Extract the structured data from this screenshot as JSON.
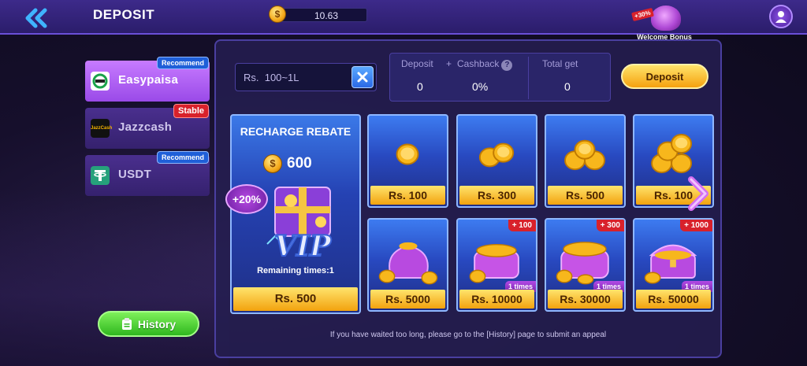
{
  "header": {
    "title": "DEPOSIT",
    "balance": "10.63",
    "welcome_bonus": "Welcome Bonus",
    "bonus_tag": "+30%"
  },
  "methods": [
    {
      "label": "Easypaisa",
      "badge": "Recommend",
      "badge_color": "#1f5fd8",
      "active": true
    },
    {
      "label": "Jazzcash",
      "badge": "Stable",
      "badge_color": "#d8212b",
      "icon_text": "JazzCash",
      "active": false
    },
    {
      "label": "USDT",
      "badge": "Recommend",
      "badge_color": "#1f5fd8",
      "active": false
    }
  ],
  "history_button": "History",
  "input": {
    "currency": "Rs.",
    "placeholder": "Rs.  100~1L"
  },
  "summary": {
    "deposit_label": "Deposit",
    "plus": "+",
    "cashback_label": "Cashback",
    "help_icon": "?",
    "total_label": "Total get",
    "deposit_value": "0",
    "cashback_value": "0%",
    "total_value": "0"
  },
  "deposit_button": "Deposit",
  "rebate": {
    "title": "RECHARGE REBATE",
    "amount": "600",
    "coin_symbol": "$",
    "bonus": "+20%",
    "vip": "VIP",
    "remaining": "Remaining times:1",
    "price": "Rs. 500"
  },
  "options_row1": [
    {
      "price": "Rs. 100",
      "coins": 1
    },
    {
      "price": "Rs. 300",
      "coins": 2
    },
    {
      "price": "Rs. 500",
      "coins": 3
    },
    {
      "price": "Rs. 100",
      "coins": 4
    }
  ],
  "options_row2": [
    {
      "price": "Rs. 5000",
      "badge": "",
      "times": "",
      "art": "pouch"
    },
    {
      "price": "Rs. 10000",
      "badge": "+ 100",
      "times": "1 times",
      "art": "purse"
    },
    {
      "price": "Rs. 30000",
      "badge": "+ 300",
      "times": "1 times",
      "art": "bag"
    },
    {
      "price": "Rs. 50000",
      "badge": "+ 1000",
      "times": "1 times",
      "art": "chest"
    }
  ],
  "appeal_note": "If you have waited too long, please go to the [History] page to submit an appeal",
  "colors": {
    "accent_gold": "#f5a10f",
    "active_method": "#b866f5",
    "panel": "#241e50",
    "green": "#2fb71f"
  }
}
